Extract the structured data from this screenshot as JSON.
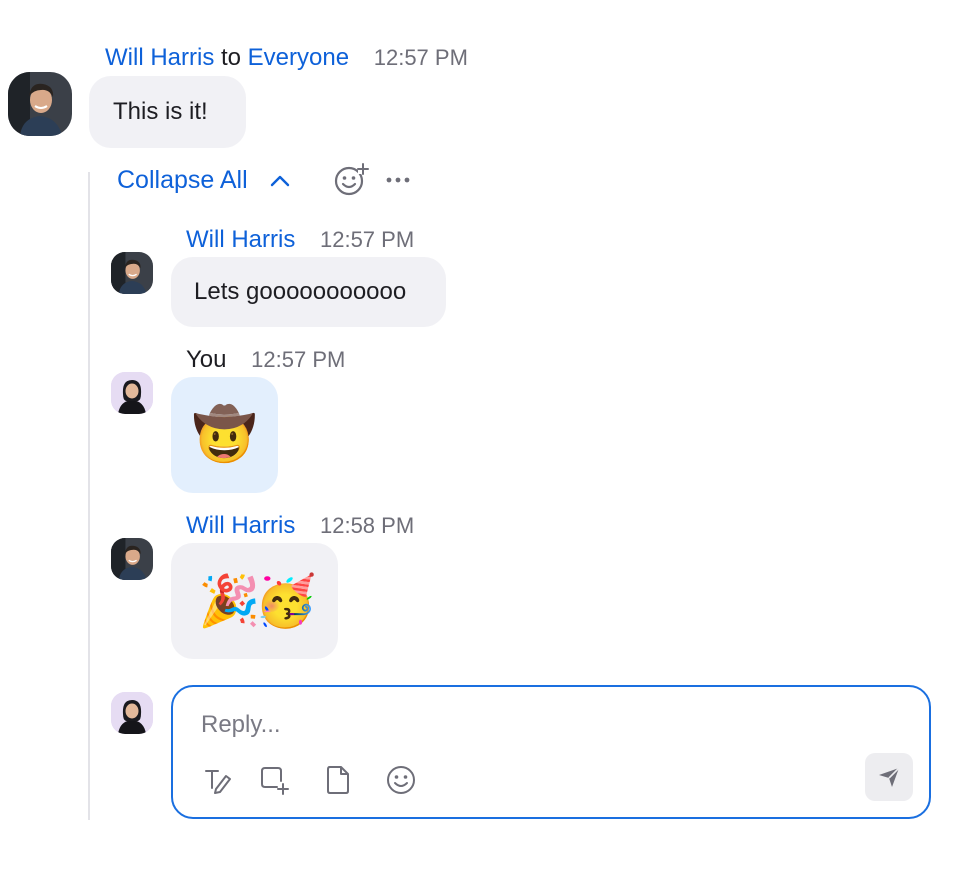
{
  "main_message": {
    "sender": "Will Harris",
    "to_word": "to",
    "recipient": "Everyone",
    "time": "12:57 PM",
    "text": "This is it!"
  },
  "thread_controls": {
    "collapse_label": "Collapse All",
    "add_reaction_icon": "add-reaction-icon",
    "more_icon": "more-horizontal-icon"
  },
  "replies": [
    {
      "sender": "Will Harris",
      "time": "12:57 PM",
      "text": "Lets gooooooooooo"
    },
    {
      "sender": "You",
      "time": "12:57 PM",
      "emoji": "🤠"
    },
    {
      "sender": "Will Harris",
      "time": "12:58 PM",
      "emoji": "🎉🥳"
    }
  ],
  "reply_box": {
    "placeholder": "Reply...",
    "tools": [
      "format-text-icon",
      "screenshot-icon",
      "file-icon",
      "emoji-icon"
    ],
    "send_icon": "send-icon"
  },
  "colors": {
    "link_blue": "#0e61d9",
    "bubble_gray": "#f1f1f5",
    "bubble_own": "#e3effd",
    "reply_border": "#1a6fe0"
  }
}
